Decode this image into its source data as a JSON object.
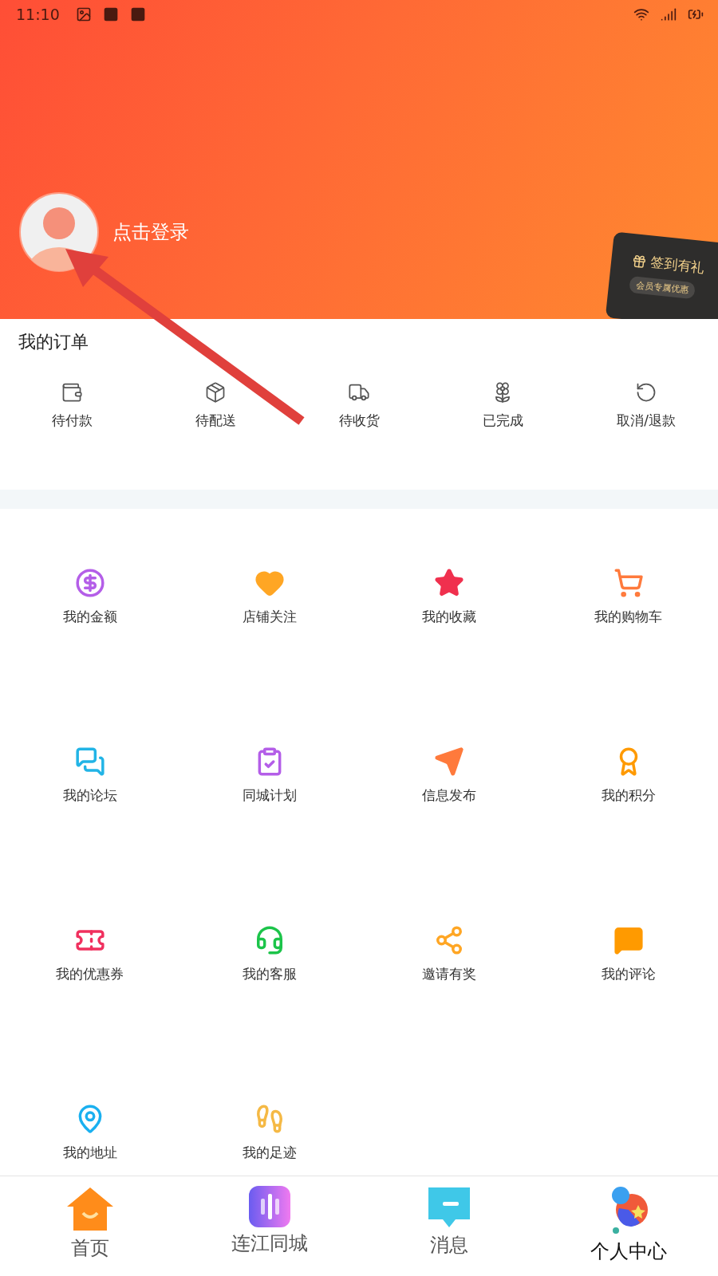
{
  "status_bar": {
    "time": "11:10"
  },
  "profile": {
    "login_text": "点击登录"
  },
  "sign_in_card": {
    "title": "签到有礼",
    "subtitle": "会员专属优惠"
  },
  "orders": {
    "title": "我的订单",
    "items": [
      {
        "label": "待付款"
      },
      {
        "label": "待配送"
      },
      {
        "label": "待收货"
      },
      {
        "label": "已完成"
      },
      {
        "label": "取消/退款"
      }
    ]
  },
  "services": [
    {
      "label": "我的金额"
    },
    {
      "label": "店铺关注"
    },
    {
      "label": "我的收藏"
    },
    {
      "label": "我的购物车"
    },
    {
      "label": "我的论坛"
    },
    {
      "label": "同城计划"
    },
    {
      "label": "信息发布"
    },
    {
      "label": "我的积分"
    },
    {
      "label": "我的优惠券"
    },
    {
      "label": "我的客服"
    },
    {
      "label": "邀请有奖"
    },
    {
      "label": "我的评论"
    },
    {
      "label": "我的地址"
    },
    {
      "label": "我的足迹"
    }
  ],
  "tab_bar": [
    {
      "label": "首页",
      "selected": false
    },
    {
      "label": "连江同城",
      "selected": false
    },
    {
      "label": "消息",
      "selected": false
    },
    {
      "label": "个人中心",
      "selected": true
    }
  ]
}
